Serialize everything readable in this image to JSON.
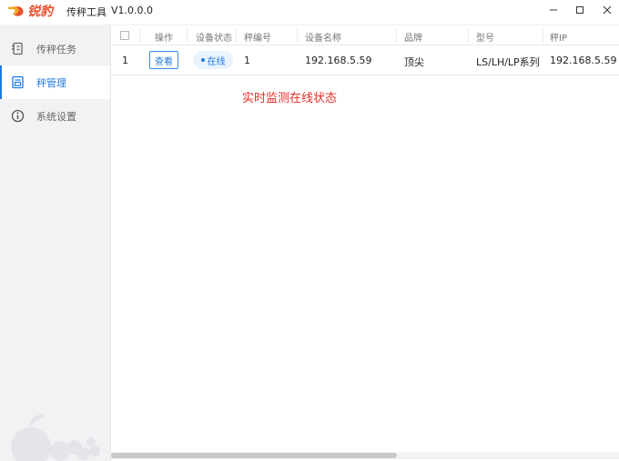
{
  "titlebar": {
    "logo_text": "锐豹",
    "app_name": "传秤工具",
    "version": "V1.0.0.0",
    "minimize_icon": "minimize-icon",
    "maximize_icon": "maximize-icon",
    "close_icon": "close-icon"
  },
  "sidebar": {
    "items": [
      {
        "label": "传秤任务",
        "icon": "task-icon",
        "active": false
      },
      {
        "label": "秤管理",
        "icon": "scale-icon",
        "active": true
      },
      {
        "label": "系统设置",
        "icon": "info-icon",
        "active": false
      }
    ]
  },
  "table": {
    "headers": [
      "操作",
      "设备状态",
      "秤编号",
      "设备名称",
      "品牌",
      "型号",
      "秤IP"
    ],
    "rows": [
      {
        "index": "1",
        "action_label": "查看",
        "status": "在线",
        "scale_no": "1",
        "device_name": "192.168.5.59",
        "brand": "顶尖",
        "model": "LS/LH/LP系列",
        "ip": "192.168.5.59"
      }
    ]
  },
  "annotation": "实时监测在线状态",
  "colors": {
    "accent": "#1f7ae0",
    "annotation": "#e5302a",
    "logo": "#e8522e",
    "sidebar_bg": "#f1f2f4"
  }
}
